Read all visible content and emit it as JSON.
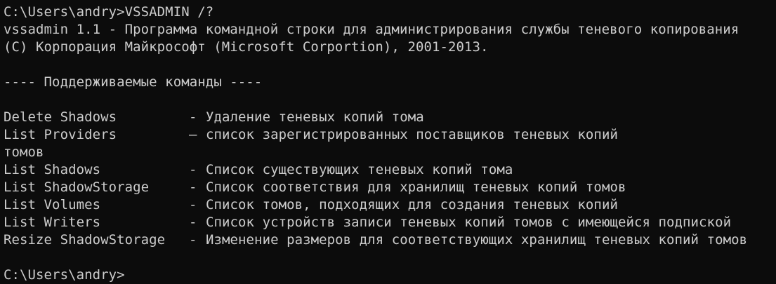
{
  "console": {
    "command_line": "C:\\Users\\andry>VSSADMIN /?",
    "header_line1": "vssadmin 1.1 - Программа командной строки для администрирования службы теневого копирования",
    "header_line2": "(C) Корпорация Майкрософт (Microsoft Corportion), 2001-2013.",
    "section_title": "---- Поддерживаемые команды ----",
    "commands": [
      {
        "name": "Delete Shadows",
        "sep": "-",
        "desc": "Удаление теневых копий тома"
      },
      {
        "name": "List Providers",
        "sep": "—",
        "desc": "список зарегистрированных поставщиков теневых копий"
      },
      {
        "name": "List Shadows",
        "sep": "-",
        "desc": "Список существующих теневых копий тома"
      },
      {
        "name": "List ShadowStorage",
        "sep": "-",
        "desc": "Список соответствия для хранилищ теневых копий томов"
      },
      {
        "name": "List Volumes",
        "sep": "-",
        "desc": "Список томов, подходящих для создания теневых копий"
      },
      {
        "name": "List Writers",
        "sep": "-",
        "desc": "Список устройств записи теневых копий томов с имеющейся подпиской"
      },
      {
        "name": "Resize ShadowStorage",
        "sep": "-",
        "desc": "Изменение размеров для соответствующих хранилищ теневых копий томов"
      }
    ],
    "wrap_continuation": "томов",
    "prompt": "C:\\Users\\andry>"
  }
}
